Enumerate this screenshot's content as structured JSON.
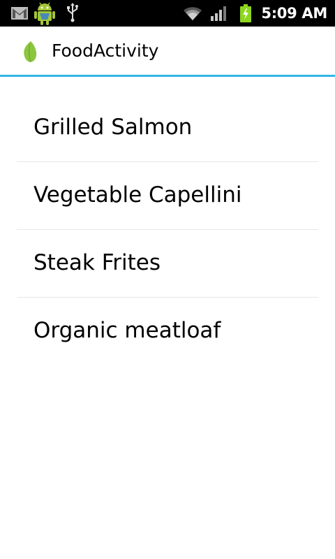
{
  "status_bar": {
    "time": "5:09 AM",
    "icons": [
      "gmail-icon",
      "android-debug-icon",
      "usb-icon",
      "wifi-icon",
      "signal-icon",
      "battery-charging-icon"
    ],
    "battery_color": "#8dd51e"
  },
  "action_bar": {
    "title": "FoodActivity",
    "app_icon": "leaf-icon",
    "accent_color": "#33b5e5",
    "icon_color": "#8cc63f"
  },
  "food_list": {
    "items": [
      {
        "label": "Grilled Salmon"
      },
      {
        "label": "Vegetable Capellini"
      },
      {
        "label": "Steak Frites"
      },
      {
        "label": "Organic meatloaf"
      }
    ]
  }
}
